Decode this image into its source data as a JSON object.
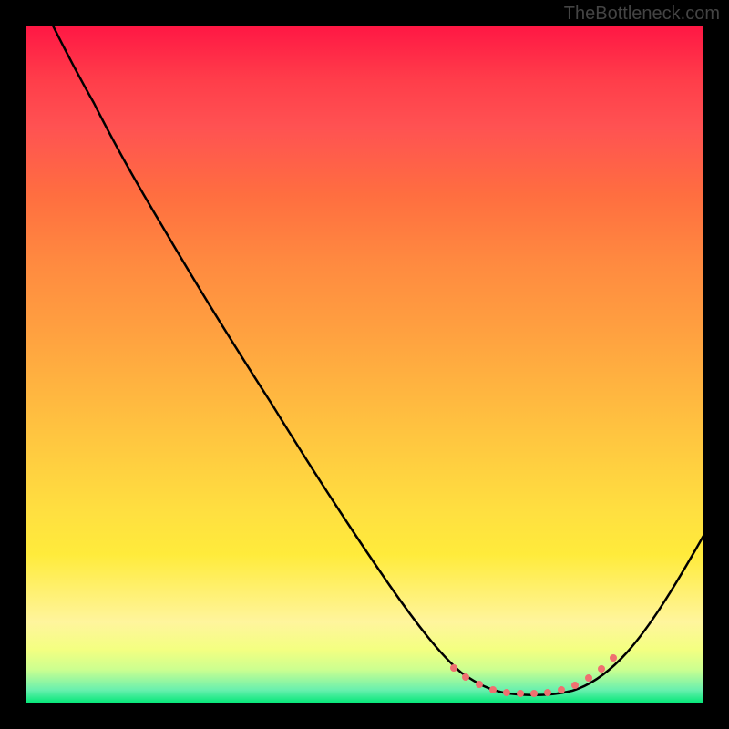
{
  "watermark": "TheBottleneck.com",
  "chart_data": {
    "type": "line",
    "title": "",
    "xlabel": "",
    "ylabel": "",
    "xlim": [
      0,
      100
    ],
    "ylim": [
      0,
      100
    ],
    "series": [
      {
        "name": "main-curve",
        "color": "#000000",
        "points": [
          {
            "x": 4,
            "y": 100
          },
          {
            "x": 8,
            "y": 93
          },
          {
            "x": 12,
            "y": 86
          },
          {
            "x": 18,
            "y": 77
          },
          {
            "x": 25,
            "y": 66
          },
          {
            "x": 32,
            "y": 55
          },
          {
            "x": 40,
            "y": 43
          },
          {
            "x": 48,
            "y": 31
          },
          {
            "x": 55,
            "y": 20
          },
          {
            "x": 60,
            "y": 12
          },
          {
            "x": 64,
            "y": 7
          },
          {
            "x": 68,
            "y": 4
          },
          {
            "x": 72,
            "y": 2
          },
          {
            "x": 76,
            "y": 2
          },
          {
            "x": 80,
            "y": 2
          },
          {
            "x": 84,
            "y": 5
          },
          {
            "x": 88,
            "y": 10
          },
          {
            "x": 92,
            "y": 17
          },
          {
            "x": 96,
            "y": 25
          },
          {
            "x": 100,
            "y": 33
          }
        ]
      },
      {
        "name": "dotted-segment",
        "color": "#e57373",
        "style": "dotted",
        "points": [
          {
            "x": 63,
            "y": 8
          },
          {
            "x": 66,
            "y": 5
          },
          {
            "x": 69,
            "y": 3
          },
          {
            "x": 72,
            "y": 2
          },
          {
            "x": 75,
            "y": 2
          },
          {
            "x": 78,
            "y": 2
          },
          {
            "x": 81,
            "y": 3
          },
          {
            "x": 84,
            "y": 5
          },
          {
            "x": 87,
            "y": 8
          }
        ]
      }
    ],
    "background_gradient": {
      "top": "#ff1744",
      "middle": "#ffeb3b",
      "bottom": "#00e676"
    }
  }
}
